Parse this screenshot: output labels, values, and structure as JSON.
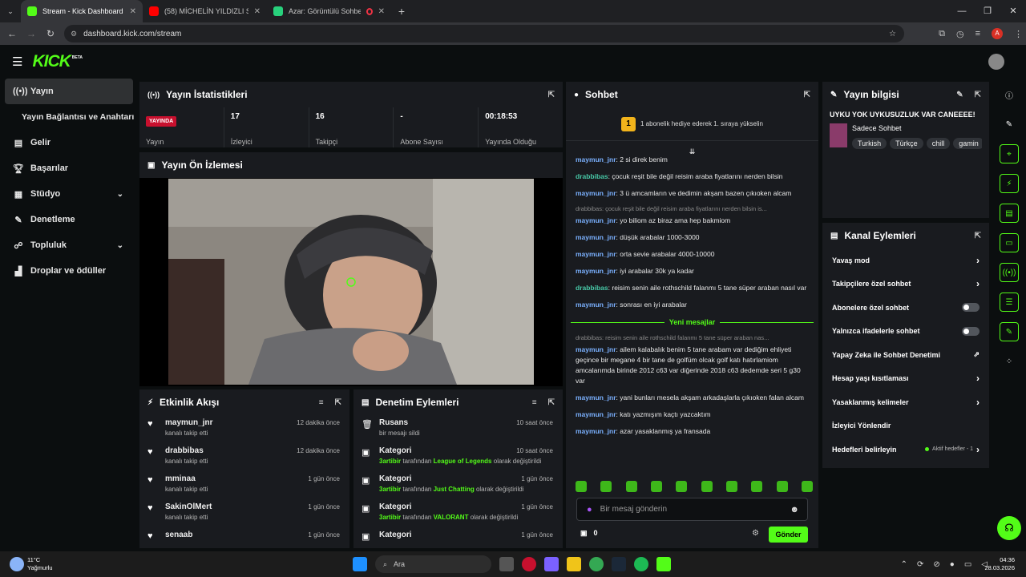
{
  "browser": {
    "tabs": [
      {
        "title": "Stream - Kick Dashboard",
        "color": "#53fc18",
        "active": true
      },
      {
        "title": "(58) MİCHELİN YILDIZLI SOKAK",
        "color": "#ff0000",
        "active": false
      },
      {
        "title": "Azar: Görüntülü Sohbet & V",
        "color": "#28d17c",
        "active": false
      }
    ],
    "url": "dashboard.kick.com/stream"
  },
  "app": {
    "logo": "KICK",
    "badge": "BETA"
  },
  "sidebar": {
    "items": [
      {
        "icon": "broadcast-icon",
        "label": "Yayın",
        "active": true
      },
      {
        "icon": "",
        "label": "Yayın Bağlantısı ve Anahtarı"
      },
      {
        "icon": "revenue-icon",
        "label": "Gelir"
      },
      {
        "icon": "trophy-icon",
        "label": "Başarılar"
      },
      {
        "icon": "studio-icon",
        "label": "Stüdyo",
        "chevron": true
      },
      {
        "icon": "moderation-icon",
        "label": "Denetleme"
      },
      {
        "icon": "community-icon",
        "label": "Topluluk",
        "chevron": true
      },
      {
        "icon": "drops-icon",
        "label": "Droplar ve ödüller"
      }
    ]
  },
  "stats": {
    "title": "Yayın İstatistikleri",
    "live_badge": "YAYINDA",
    "items": [
      {
        "value": "",
        "label": "Yayın"
      },
      {
        "value": "17",
        "label": "İzleyici"
      },
      {
        "value": "16",
        "label": "Takipçi"
      },
      {
        "value": "-",
        "label": "Abone Sayısı"
      },
      {
        "value": "00:18:53",
        "label": "Yayında Olduğu"
      }
    ]
  },
  "preview": {
    "title": "Yayın Ön İzlemesi"
  },
  "activity": {
    "title": "Etkinlik Akışı",
    "items": [
      {
        "name": "maymun_jnr",
        "sub": "kanalı takip etti",
        "time": "12 dakika önce"
      },
      {
        "name": "drabbibas",
        "sub": "kanalı takip etti",
        "time": "12 dakika önce"
      },
      {
        "name": "mminaa",
        "sub": "kanalı takip etti",
        "time": "1 gün önce"
      },
      {
        "name": "SakinOlMert",
        "sub": "kanalı takip etti",
        "time": "1 gün önce"
      },
      {
        "name": "senaab",
        "sub": "",
        "time": "1 gün önce"
      }
    ]
  },
  "moderation": {
    "title": "Denetim Eylemleri",
    "items": [
      {
        "name": "Rusans",
        "pre": "bir mesajı sildi",
        "actor": "",
        "mid": "",
        "game": "",
        "post": "",
        "time": "10 saat önce"
      },
      {
        "name": "Kategori",
        "pre": "",
        "actor": "3artibir",
        "mid": " tarafından ",
        "game": "League of Legends",
        "post": " olarak değiştirildi",
        "time": "10 saat önce"
      },
      {
        "name": "Kategori",
        "pre": "",
        "actor": "3artibir",
        "mid": " tarafından ",
        "game": "Just Chatting",
        "post": " olarak değiştirildi",
        "time": "1 gün önce"
      },
      {
        "name": "Kategori",
        "pre": "",
        "actor": "3artibir",
        "mid": " tarafından ",
        "game": "VALORANT",
        "post": " olarak değiştirildi",
        "time": "1 gün önce"
      },
      {
        "name": "Kategori",
        "pre": "",
        "actor": "",
        "mid": "",
        "game": "",
        "post": "",
        "time": "1 gün önce"
      }
    ]
  },
  "chat": {
    "title": "Sohbet",
    "goal": "1 abonelik hediye ederek 1. sıraya yükselin",
    "goal_num": "1",
    "messages": [
      {
        "reply": "",
        "user": "maymun_jnr",
        "cls": "u1",
        "text": "2 si direk benim"
      },
      {
        "reply": "",
        "user": "drabbibas",
        "cls": "u2",
        "text": "çocuk reşit bile değil reisim araba fiyatlarını nerden bilsin"
      },
      {
        "reply": "",
        "user": "maymun_jnr",
        "cls": "u1",
        "text": "3 ü amcamların ve dedimin akşam bazen çıkıoken alcam"
      },
      {
        "reply": "drabbibas: çocuk reşit bile değil reisim araba fiyatlarını nerden bilsin is...",
        "user": "maymun_jnr",
        "cls": "u1",
        "text": "yo biliom az biraz ama hep bakmiom"
      },
      {
        "reply": "",
        "user": "maymun_jnr",
        "cls": "u1",
        "text": "düşük arabalar 1000-3000"
      },
      {
        "reply": "",
        "user": "maymun_jnr",
        "cls": "u1",
        "text": "orta sevie arabalar 4000-10000"
      },
      {
        "reply": "",
        "user": "maymun_jnr",
        "cls": "u1",
        "text": "iyi arabalar 30k ya kadar"
      },
      {
        "reply": "",
        "user": "drabbibas",
        "cls": "u2",
        "text": "reisim senin aile rothschild falanmı 5 tane süper araban nasıl var"
      },
      {
        "reply": "",
        "user": "maymun_jnr",
        "cls": "u1",
        "text": "sonrası en iyi arabalar"
      }
    ],
    "new_label": "Yeni mesajlar",
    "messages2": [
      {
        "reply": "drabbibas: reisim senin aile rothschild falanmı 5 tane süper araban nas...",
        "user": "maymun_jnr",
        "cls": "u1",
        "text": "ailem kalabalık benim 5 tane arabam var dediğim ehliyeti geçince bir megane 4 bir tane de golfüm olcak golf katı hatırlamiom amcalarımda birinde 2012 c63 var diğerinde 2018 c63 dedemde seri 5 g30 var"
      },
      {
        "reply": "",
        "user": "maymun_jnr",
        "cls": "u1",
        "text": "yani bunları mesela akşam arkadaşlarla çıkıoken falan alcam"
      },
      {
        "reply": "",
        "user": "maymun_jnr",
        "cls": "u1",
        "text": "katı yazmışım kaçtı yazcaktım"
      },
      {
        "reply": "",
        "user": "maymun_jnr",
        "cls": "u1",
        "text": "azar yasaklanmış ya fransada"
      }
    ],
    "placeholder": "Bir mesaj gönderin",
    "points": "0",
    "send": "Gönder"
  },
  "streaminfo": {
    "title": "Yayın bilgisi",
    "stream_title": "UYKU YOK UYKUSUZLUK VAR CANEEEE!",
    "category": "Sadece Sohbet",
    "tags": [
      "Turkish",
      "Türkçe",
      "chill",
      "gamin"
    ]
  },
  "channel": {
    "title": "Kanal Eylemleri",
    "rows": [
      {
        "label": "Yavaş mod",
        "kind": "chevron"
      },
      {
        "label": "Takipçilere özel sohbet",
        "kind": "chevron"
      },
      {
        "label": "Abonelere özel sohbet",
        "kind": "toggle"
      },
      {
        "label": "Yalnızca ifadelerle sohbet",
        "kind": "toggle"
      },
      {
        "label": "Yapay Zeka ile Sohbet Denetimi",
        "kind": "external"
      },
      {
        "label": "Hesap yaşı kısıtlaması",
        "kind": "chevron"
      },
      {
        "label": "Yasaklanmış kelimeler",
        "kind": "chevron"
      },
      {
        "label": "İzleyici Yönlendir",
        "kind": "none"
      },
      {
        "label": "Hedefleri belirleyin",
        "kind": "goal"
      }
    ],
    "goal_status": "Aktif hedefler - 1"
  },
  "taskbar": {
    "weather": "11°C",
    "weather_sub": "Yağmurlu",
    "search": "Ara",
    "time": "04:36",
    "date": "28.03.2026"
  }
}
